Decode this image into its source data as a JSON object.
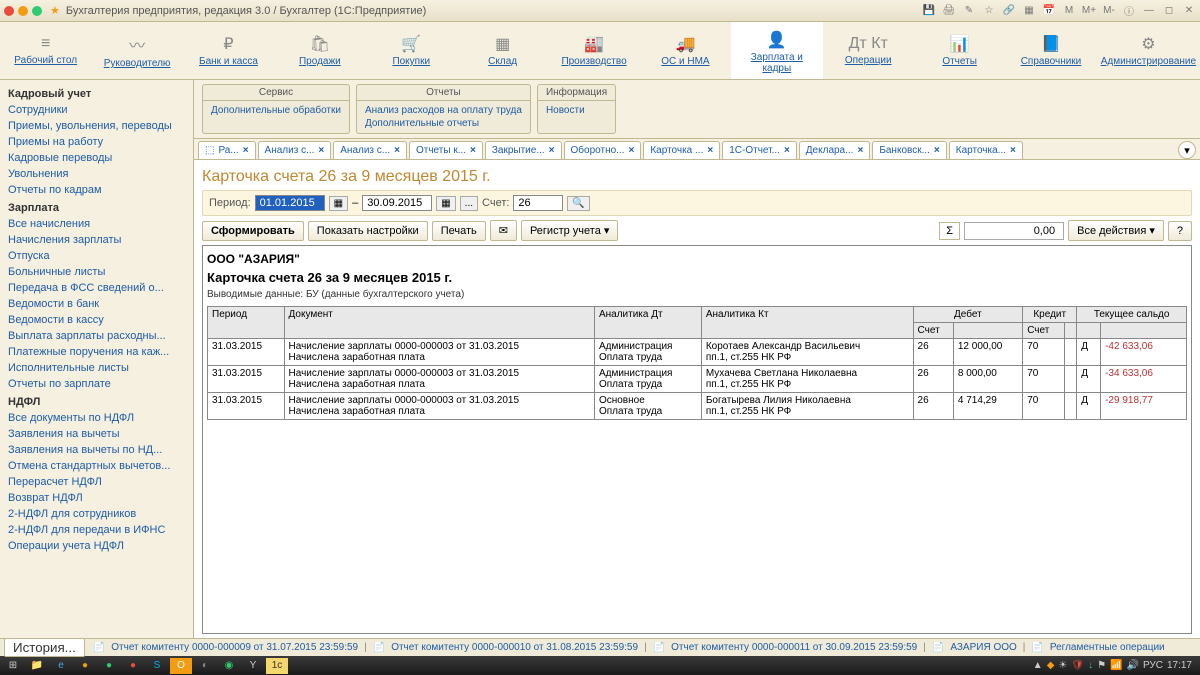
{
  "titlebar": {
    "title": "Бухгалтерия предприятия, редакция 3.0 / Бухгалтер  (1С:Предприятие)"
  },
  "nav": [
    {
      "icon": "≡",
      "label": "Рабочий стол"
    },
    {
      "icon": "〰",
      "label": "Руководителю"
    },
    {
      "icon": "₽",
      "label": "Банк и касса"
    },
    {
      "icon": "🛍",
      "label": "Продажи"
    },
    {
      "icon": "🛒",
      "label": "Покупки"
    },
    {
      "icon": "▦",
      "label": "Склад"
    },
    {
      "icon": "🏭",
      "label": "Производство"
    },
    {
      "icon": "🚚",
      "label": "ОС и НМА"
    },
    {
      "icon": "👤",
      "label": "Зарплата и кадры",
      "active": true
    },
    {
      "icon": "Дт Кт",
      "label": "Операции"
    },
    {
      "icon": "📊",
      "label": "Отчеты"
    },
    {
      "icon": "📘",
      "label": "Справочники"
    },
    {
      "icon": "⚙",
      "label": "Администрирование"
    }
  ],
  "sidebar": {
    "sections": [
      {
        "title": "Кадровый учет",
        "items": [
          "Сотрудники",
          "Приемы, увольнения, переводы",
          "Приемы на работу",
          "Кадровые переводы",
          "Увольнения",
          "Отчеты по кадрам"
        ]
      },
      {
        "title": "Зарплата",
        "items": [
          "Все начисления",
          "Начисления зарплаты",
          "Отпуска",
          "Больничные листы",
          "Передача в ФСС сведений о...",
          "Ведомости в банк",
          "Ведомости в кассу",
          "Выплата зарплаты расходны...",
          "Платежные поручения на каж...",
          "Исполнительные листы",
          "Отчеты по зарплате"
        ]
      },
      {
        "title": "НДФЛ",
        "items": [
          "Все документы по НДФЛ",
          "Заявления на вычеты",
          "Заявления на вычеты по НД...",
          "Отмена стандартных вычетов...",
          "Перерасчет НДФЛ",
          "Возврат НДФЛ",
          "2-НДФЛ для сотрудников",
          "2-НДФЛ для передачи в ИФНС",
          "Операции учета НДФЛ"
        ]
      }
    ]
  },
  "services": [
    {
      "title": "Сервис",
      "links": [
        "Дополнительные обработки"
      ]
    },
    {
      "title": "Отчеты",
      "links": [
        "Анализ расходов на оплату труда",
        "Дополнительные отчеты"
      ]
    },
    {
      "title": "Информация",
      "links": [
        "Новости"
      ]
    }
  ],
  "tabs": [
    "Ра...",
    "Анализ с...",
    "Анализ с...",
    "Отчеты к...",
    "Закрытие...",
    "Оборотно...",
    "Карточка ...",
    "1С-Отчет...",
    "Деклара...",
    "Банковск...",
    "Карточка..."
  ],
  "report": {
    "title": "Карточка счета 26 за 9 месяцев 2015 г.",
    "period_label": "Период:",
    "date_from": "01.01.2015",
    "date_to": "30.09.2015",
    "account_label": "Счет:",
    "account": "26",
    "toolbar": {
      "form": "Сформировать",
      "settings": "Показать настройки",
      "print": "Печать",
      "register": "Регистр учета",
      "all_actions": "Все действия",
      "sum": "0,00"
    },
    "org": "ООО \"АЗАРИЯ\"",
    "subtitle": "Карточка счета 26 за 9 месяцев 2015 г.",
    "meta": "Выводимые данные:   БУ (данные бухгалтерского учета)",
    "columns": {
      "period": "Период",
      "doc": "Документ",
      "an_dt": "Аналитика Дт",
      "an_kt": "Аналитика Кт",
      "debit": "Дебет",
      "credit": "Кредит",
      "saldo": "Текущее сальдо",
      "acc": "Счет"
    },
    "rows": [
      {
        "period": "31.03.2015",
        "doc": "Начисление зарплаты 0000-000003 от 31.03.2015\nНачислена заработная плата",
        "an_dt": "Администрация\nОплата труда",
        "an_kt": "Коротаев Александр Васильевич\nпп.1, ст.255 НК РФ",
        "d_acc": "26",
        "d_sum": "12 000,00",
        "c_acc": "70",
        "c_sum": "",
        "s_dc": "Д",
        "s_val": "-42 633,06"
      },
      {
        "period": "31.03.2015",
        "doc": "Начисление зарплаты 0000-000003 от 31.03.2015\nНачислена заработная плата",
        "an_dt": "Администрация\nОплата труда",
        "an_kt": "Мухачева Светлана Николаевна\nпп.1, ст.255 НК РФ",
        "d_acc": "26",
        "d_sum": "8 000,00",
        "c_acc": "70",
        "c_sum": "",
        "s_dc": "Д",
        "s_val": "-34 633,06"
      },
      {
        "period": "31.03.2015",
        "doc": "Начисление зарплаты 0000-000003 от 31.03.2015\nНачислена заработная плата",
        "an_dt": "Основное\nОплата труда",
        "an_kt": "Богатырева Лилия Николаевна\nпп.1, ст.255 НК РФ",
        "d_acc": "26",
        "d_sum": "4 714,29",
        "c_acc": "70",
        "c_sum": "",
        "s_dc": "Д",
        "s_val": "-29 918,77"
      }
    ]
  },
  "statusbar": {
    "history": "История...",
    "items": [
      "Отчет комитенту 0000-000009 от 31.07.2015 23:59:59",
      "Отчет комитенту 0000-000010 от 31.08.2015 23:59:59",
      "Отчет комитенту 0000-000011 от 30.09.2015 23:59:59",
      "АЗАРИЯ ООО",
      "Регламентные операции"
    ]
  },
  "taskbar": {
    "time": "17:17",
    "lang": "РУС"
  }
}
